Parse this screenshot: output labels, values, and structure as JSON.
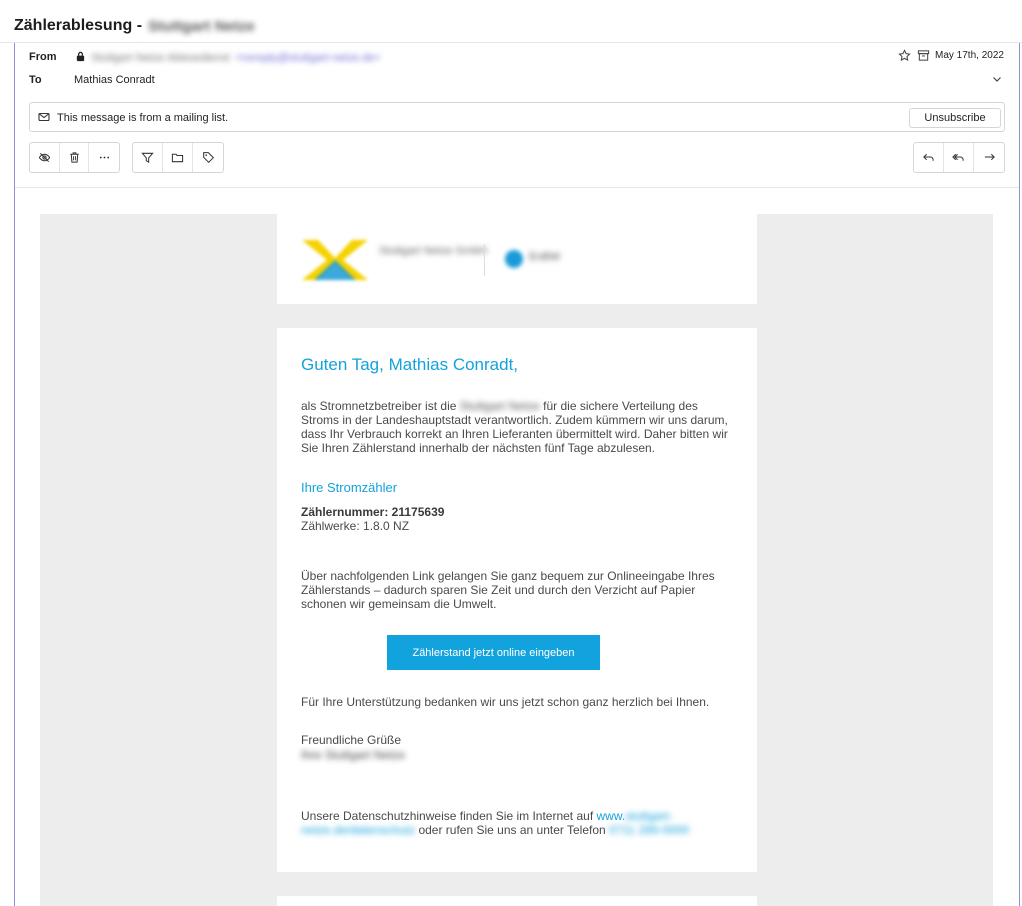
{
  "subject": {
    "title": "Zählerablesung -",
    "blurred": "Stuttgart Netze"
  },
  "header": {
    "from_label": "From",
    "from_name": "Stuttgart Netze Ablesedienst",
    "from_email": "<noreply@stuttgart-netze.de>",
    "to_label": "To",
    "to_name": "Mathias Conradt",
    "date": "May 17th, 2022"
  },
  "mailing_list": {
    "text": "This message is from a mailing list.",
    "unsubscribe_label": "Unsubscribe"
  },
  "email": {
    "logo_text": "Stuttgart Netze GmbH",
    "logo_text2": "EnBW",
    "greeting": "Guten Tag, Mathias Conradt,",
    "para1_pre": "als Stromnetzbetreiber ist die",
    "para1_blur": "Stuttgart Netze",
    "para1_post": "für die sichere Verteilung des Stroms in der Landeshauptstadt verantwortlich. Zudem kümmern wir uns darum, dass Ihr Verbrauch korrekt an Ihren Lieferanten übermittelt wird. Daher bitten wir Sie Ihren Zählerstand innerhalb der nächsten fünf Tage abzulesen.",
    "section_title": "Ihre Stromzähler",
    "meter_number": "Zählernummer: 21175639",
    "meter_works": "Zählwerke: 1.8.0 NZ",
    "para2": "Über nachfolgenden Link gelangen Sie ganz bequem zur Onlineeingabe Ihres Zählerstands – dadurch sparen Sie Zeit und durch den Verzicht auf Papier schonen wir gemeinsam die Umwelt.",
    "cta_label": "Zählerstand jetzt online eingeben",
    "thanks": "Für Ihre Unterstützung bedanken wir uns jetzt schon ganz herzlich bei Ihnen.",
    "closing": "Freundliche Grüße",
    "signature_blur": "Ihre Stuttgart Netze",
    "privacy_pre": "Unsere Datenschutzhinweise finden Sie im Internet auf",
    "privacy_link": "www.",
    "privacy_link_blur": "stuttgart-",
    "privacy_link_blur2": "netze.de/datenschutz",
    "phone_pre": "oder rufen Sie uns an unter Telefon",
    "phone_blur": "0711 289-0000"
  },
  "colors": {
    "accent": "#12a2de",
    "frame": "#8f8fd6"
  }
}
